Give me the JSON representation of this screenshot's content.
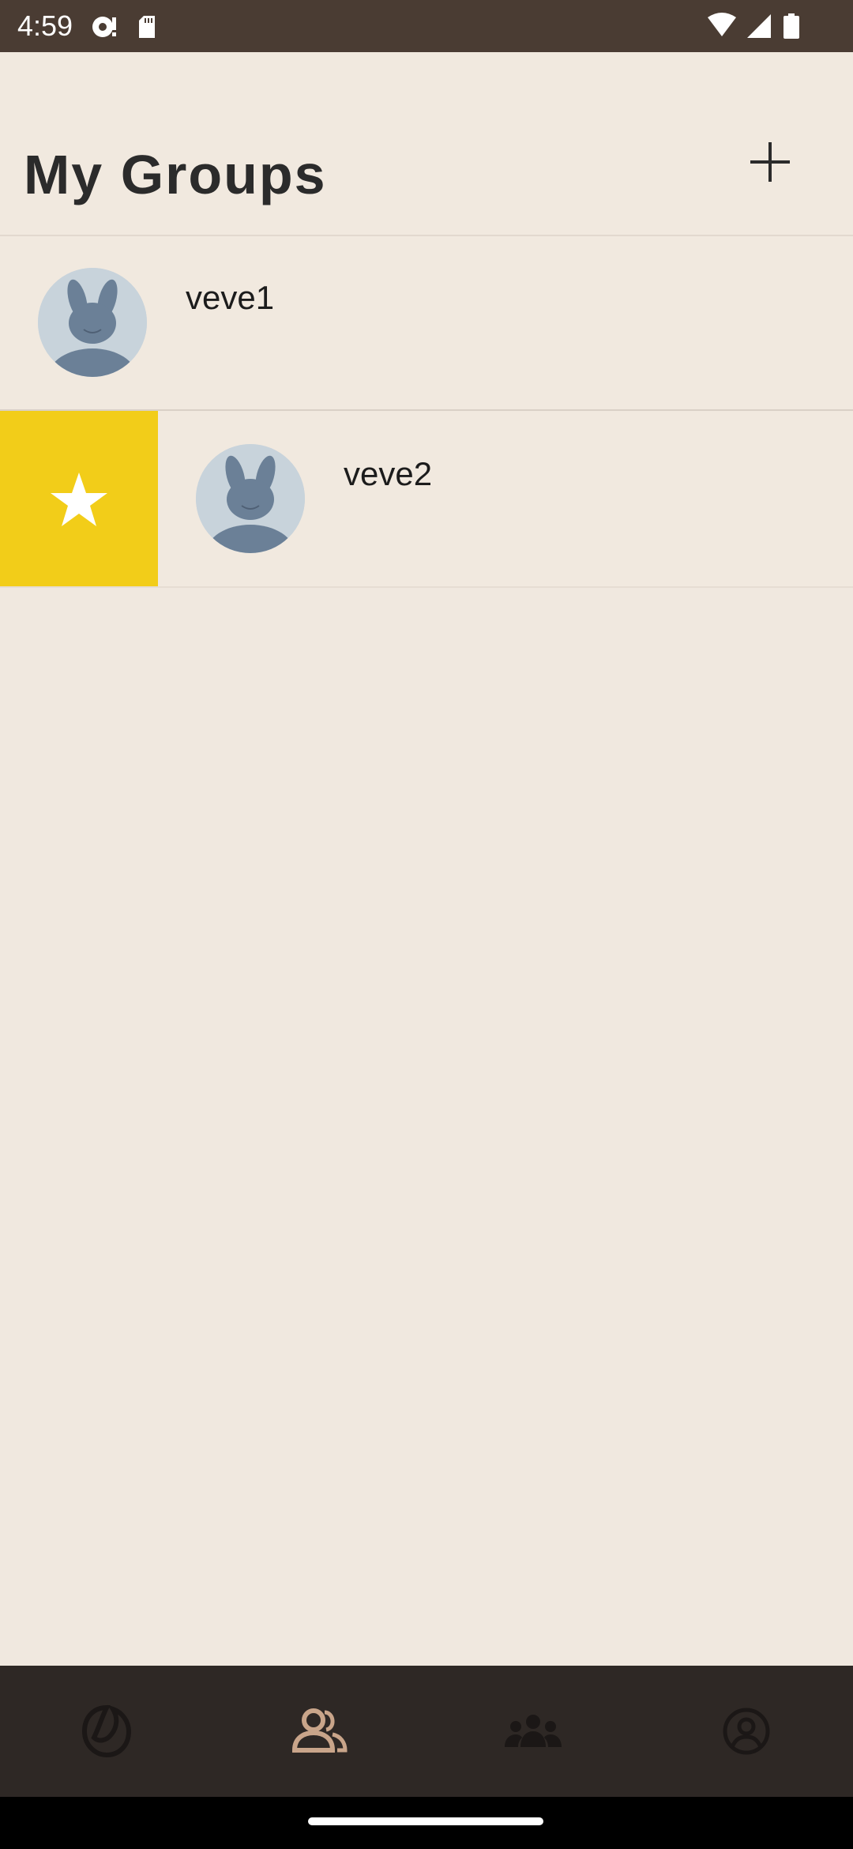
{
  "status_bar": {
    "time": "4:59",
    "icons": [
      "sync-icon",
      "sd-card-icon",
      "wifi-icon",
      "signal-icon",
      "battery-icon"
    ]
  },
  "header": {
    "title": "My Groups",
    "add_icon": "plus-icon"
  },
  "groups": [
    {
      "name": "veve1",
      "avatar": "rabbit-avatar",
      "favorite_action_visible": false
    },
    {
      "name": "veve2",
      "avatar": "rabbit-avatar",
      "favorite_action_visible": true
    }
  ],
  "swipe_action": {
    "icon": "star-icon",
    "color": "#f2cd19"
  },
  "bottom_nav": {
    "items": [
      {
        "icon": "home-icon",
        "active": false
      },
      {
        "icon": "friends-icon",
        "active": true
      },
      {
        "icon": "groups-icon",
        "active": false
      },
      {
        "icon": "profile-icon",
        "active": false
      }
    ],
    "active_color": "#c9a58a",
    "inactive_color": "#1b1716"
  },
  "colors": {
    "background": "#f0e8df",
    "status_bar": "#4a3c33",
    "nav_bar": "#2e2825"
  }
}
